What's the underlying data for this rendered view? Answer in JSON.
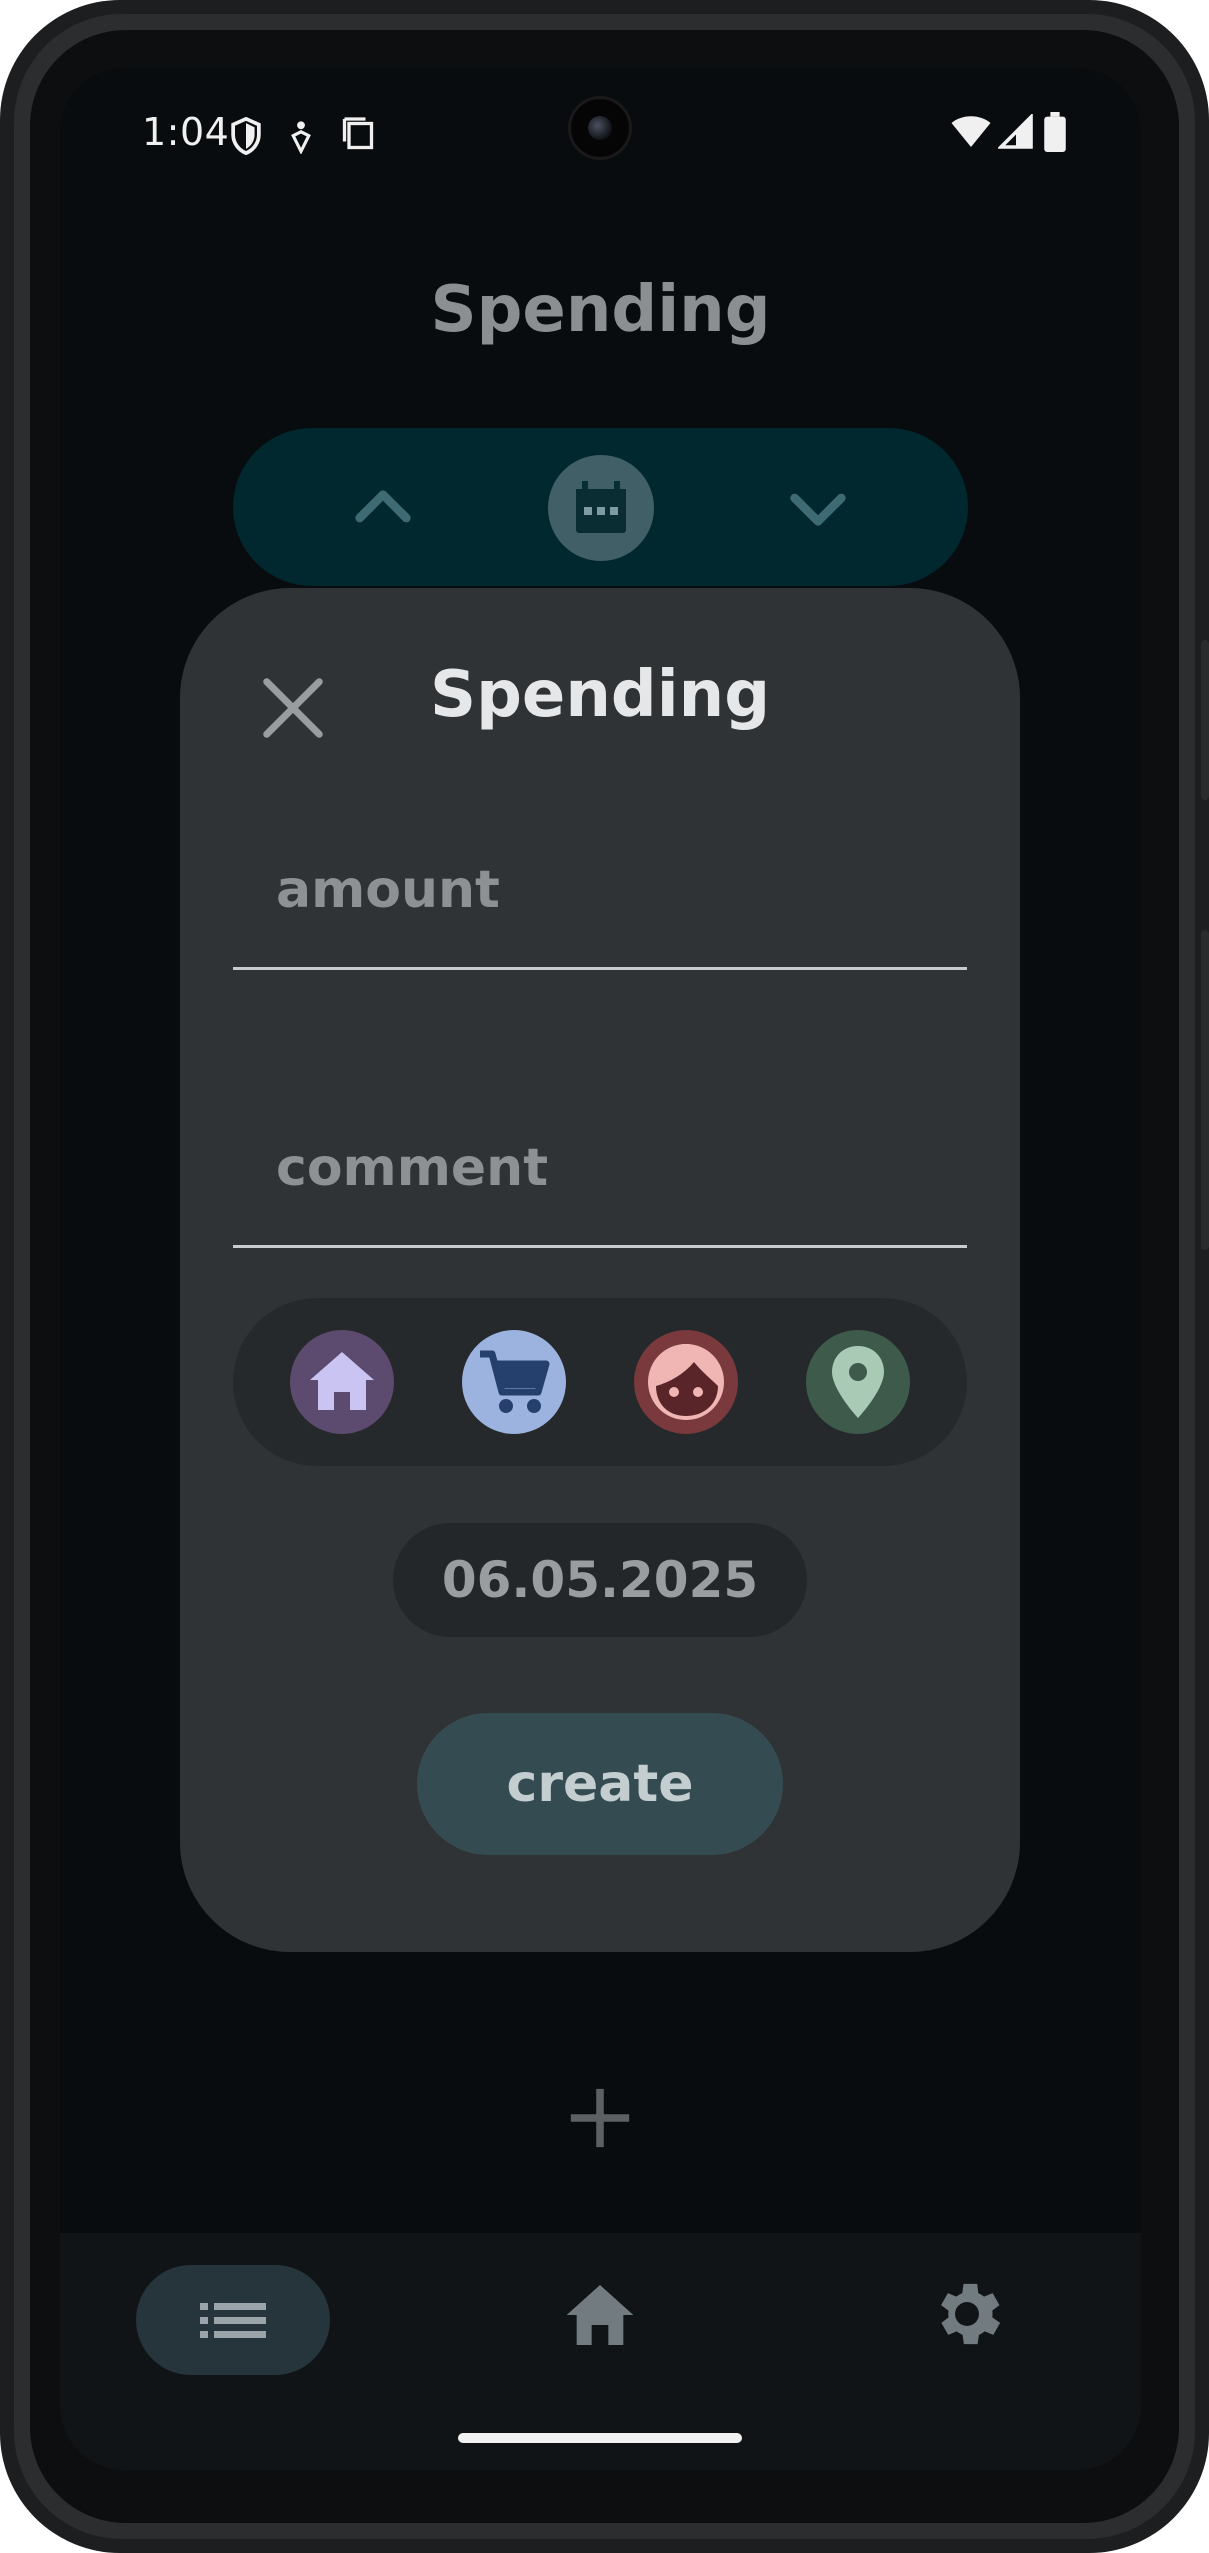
{
  "status_bar": {
    "time": "1:04",
    "icons": [
      "shield-icon",
      "accessibility-icon",
      "screen-copy-icon",
      "wifi-icon",
      "cell-signal-icon",
      "battery-icon"
    ]
  },
  "header": {
    "title": "Spending"
  },
  "month_selector": {
    "icons": [
      "chevron-up-icon",
      "calendar-icon",
      "chevron-down-icon"
    ]
  },
  "dialog": {
    "title": "Spending",
    "amount_placeholder": "amount",
    "comment_placeholder": "comment",
    "categories": [
      {
        "icon": "home-icon",
        "color": "#5c4b6e",
        "glyph_color": "#c9c4f2"
      },
      {
        "icon": "cart-icon",
        "color": "#9db3df",
        "glyph_color": "#26406e"
      },
      {
        "icon": "face-icon",
        "color": "#7a393c",
        "glyph_color": "#f0b6b4"
      },
      {
        "icon": "location-icon",
        "color": "#3e5a4a",
        "glyph_color": "#a9cbb6"
      }
    ],
    "date": "06.05.2025",
    "create_label": "create"
  },
  "bottom_nav": {
    "items": [
      "list-icon",
      "home-icon",
      "settings-icon"
    ],
    "active": "list-icon"
  },
  "colors": {
    "background": "#090c0e",
    "dialog": "#2f3336",
    "month_bar": "#00282e",
    "create_button": "#334b51"
  }
}
